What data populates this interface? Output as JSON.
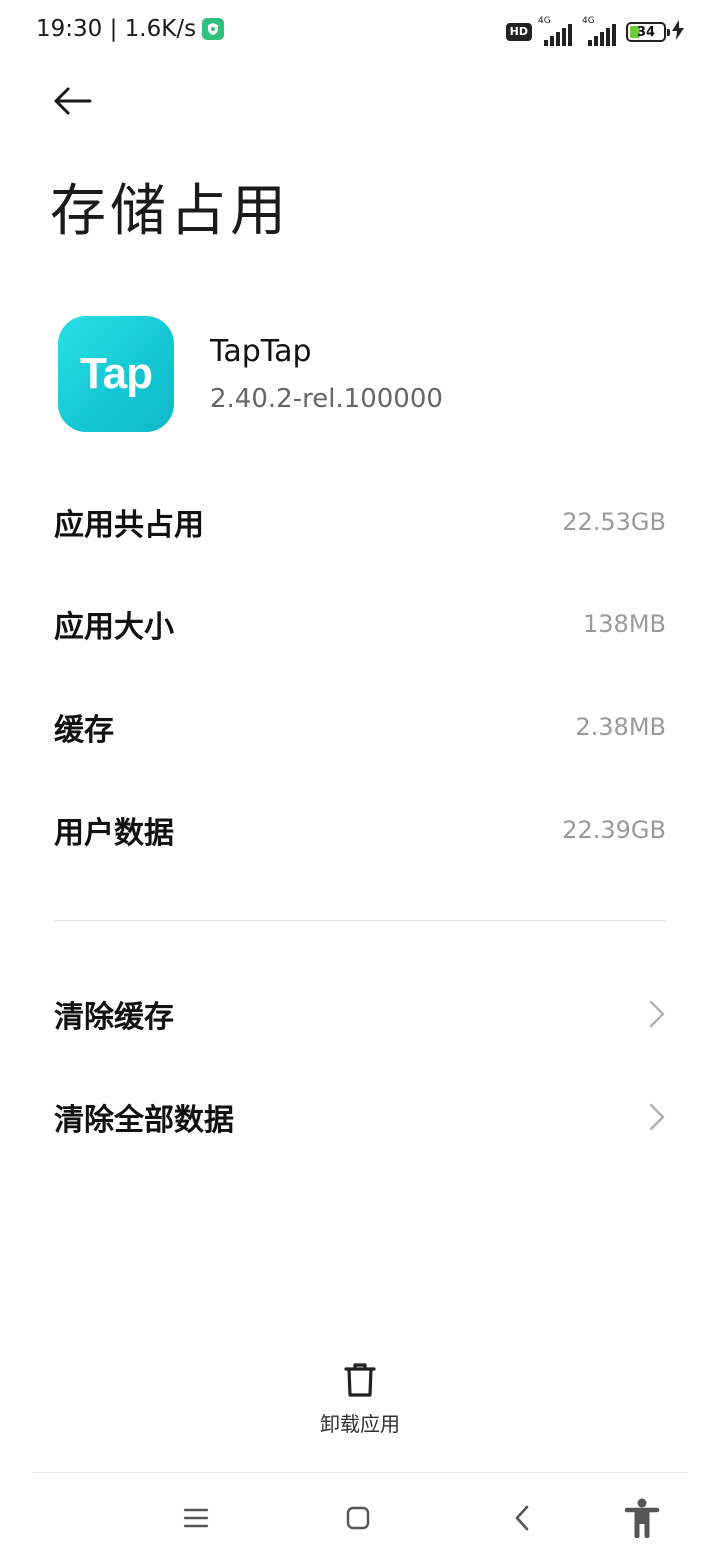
{
  "status_bar": {
    "time_speed": "19:30 | 1.6K/s",
    "hd": "HD",
    "network_1": "4G",
    "network_2": "4G",
    "battery": "34"
  },
  "header": {
    "back_icon": "arrow-left-icon",
    "title": "存储占用"
  },
  "app": {
    "icon_text": "Tap",
    "name": "TapTap",
    "version": "2.40.2-rel.100000"
  },
  "storage": [
    {
      "label": "应用共占用",
      "value": "22.53GB"
    },
    {
      "label": "应用大小",
      "value": "138MB"
    },
    {
      "label": "缓存",
      "value": "2.38MB"
    },
    {
      "label": "用户数据",
      "value": "22.39GB"
    }
  ],
  "actions": [
    {
      "label": "清除缓存",
      "icon": "chevron-right-icon"
    },
    {
      "label": "清除全部数据",
      "icon": "chevron-right-icon"
    }
  ],
  "bottom_action": {
    "icon": "trash-icon",
    "label": "卸载应用"
  },
  "nav_bar": {
    "menu_icon": "menu-icon",
    "home_icon": "home-icon",
    "back_icon": "back-icon",
    "accessibility_icon": "accessibility-icon"
  },
  "colors": {
    "app_icon": "#14c6d4",
    "battery_fill": "#6ecb3c",
    "shield": "#2ec27e"
  }
}
